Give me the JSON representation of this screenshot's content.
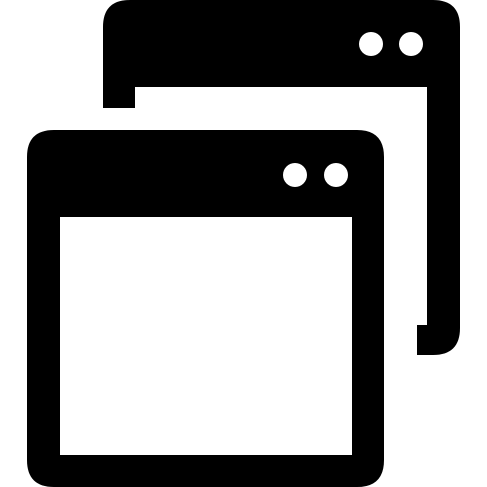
{
  "icon": {
    "name": "multiple-windows-icon",
    "fill_color": "#000000",
    "background_color": "#ffffff"
  }
}
